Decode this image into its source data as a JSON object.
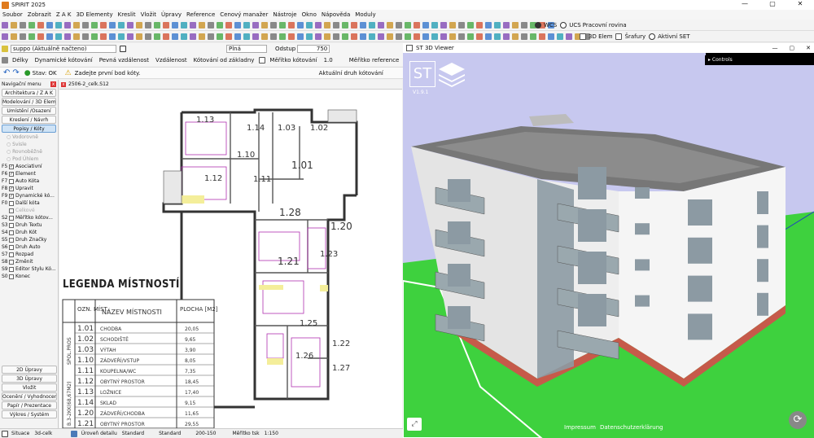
{
  "window": {
    "title": "SPIRIT 2025",
    "controls": [
      "—",
      "▢",
      "✕"
    ]
  },
  "menu": [
    "Soubor",
    "Zobrazit",
    "Z A K",
    "3D Elementy",
    "Kreslit",
    "Vložit",
    "Úpravy",
    "Reference",
    "Cenový manažer",
    "Nástroje",
    "Okno",
    "Nápověda",
    "Moduly"
  ],
  "toolbar": {
    "wcs": "WCS",
    "ucs": "UCS",
    "plane": "Pracovní rovina",
    "elem3d": "3D Elem",
    "hatch": "Šrafury",
    "active_set": "Aktivní SET"
  },
  "layer": {
    "value": "suppo (Aktuálně načteno)",
    "line": "Plná",
    "offset_label": "Odstup",
    "offset_value": "750"
  },
  "dimbar": {
    "items": [
      "Délky",
      "Dynamické kótování",
      "Pevná vzdálenost",
      "Vzdálenost",
      "Kótování od základny"
    ],
    "scale_label": "Měřítko kótování",
    "scale_value": "1.0",
    "ref_label": "Měřítko reference"
  },
  "cmdline": {
    "status": "Stav: OK",
    "prompt": "Zadejte první bod kóty.",
    "dim_type": "Aktuální druh kótování"
  },
  "nav": {
    "header": "Navigační menu",
    "top_buttons": [
      "Architektura / Z A K",
      "Modelování / 3D Elem...",
      "Umístění /Osazení",
      "Kreslení / Návrh",
      "Popisy / Kóty"
    ],
    "radios": [
      "Vodorovně",
      "Svisle",
      "Rovnoběžně",
      "Pod Úhlem"
    ],
    "commands": [
      {
        "key": "F5",
        "label": "Asociativní",
        "checked": true
      },
      {
        "key": "F6",
        "label": "Element",
        "checked": true
      },
      {
        "key": "F7",
        "label": "Auto Kóta",
        "checked": false
      },
      {
        "key": "F8",
        "label": "Upravit",
        "checked": true
      },
      {
        "key": "F9",
        "label": "Dynamické kó...",
        "checked": true
      },
      {
        "key": "F0",
        "label": "Další kóta",
        "checked": false
      },
      {
        "key": "",
        "label": "Celkové",
        "checked": false,
        "disabled": true
      },
      {
        "key": "S2",
        "label": "Měřítko kótov...",
        "checked": false
      },
      {
        "key": "S3",
        "label": "Druh Textu",
        "checked": false
      },
      {
        "key": "S4",
        "label": "Druh Kót",
        "checked": false
      },
      {
        "key": "S5",
        "label": "Druh Značky",
        "checked": false
      },
      {
        "key": "S6",
        "label": "Druh Auto",
        "checked": false
      },
      {
        "key": "S7",
        "label": "Rozpad",
        "checked": false
      },
      {
        "key": "S8",
        "label": "Změnit",
        "checked": false
      },
      {
        "key": "S9",
        "label": "Editor Stylu Kó...",
        "checked": false
      },
      {
        "key": "S0",
        "label": "Konec",
        "checked": false
      }
    ],
    "bottom_buttons": [
      "2D Úpravy",
      "3D Úpravy",
      "Vložit",
      "Ocenění / Vyhodnocení",
      "Papír / Prezentace",
      "Výkres / Systém"
    ]
  },
  "document": {
    "tab": "2506-2_celk.S12"
  },
  "legend": {
    "title": "LEGENDA MÍSTNOSTÍ",
    "col_num": "OZN. MÍST.",
    "col_name": "NÁZEV MÍSTNOSTI",
    "col_area": "PLOCHA [M2]",
    "group1": "SPOL.PROS",
    "group2": "B.3-2KK(68,67M2)",
    "rows": [
      {
        "num": "1.01",
        "name": "CHODBA",
        "area": "20,05"
      },
      {
        "num": "1.02",
        "name": "SCHODIŠTĚ",
        "area": "9,65"
      },
      {
        "num": "1.03",
        "name": "VÝTAH",
        "area": "3,90"
      },
      {
        "num": "1.10",
        "name": "ZÁDVEŘÍ/VSTUP",
        "area": "8,05"
      },
      {
        "num": "1.11",
        "name": "KOUPELNA/WC",
        "area": "7,35"
      },
      {
        "num": "1.12",
        "name": "OBYTNÝ PROSTOR",
        "area": "18,45"
      },
      {
        "num": "1.13",
        "name": "LOŽNICE",
        "area": "17,40"
      },
      {
        "num": "1.14",
        "name": "SKLAD",
        "area": "9,15"
      },
      {
        "num": "1.20",
        "name": "ZÁDVEŘÍ/CHODBA",
        "area": "11,65"
      },
      {
        "num": "1.21",
        "name": "OBYTNÝ PROSTOR",
        "area": "29,55"
      }
    ]
  },
  "plan_rooms": [
    "1.13",
    "1.14",
    "1.03",
    "1.02",
    "1.10",
    "1.11",
    "1.12",
    "1.01",
    "1.28",
    "1.20",
    "1.21",
    "1.23",
    "1.25",
    "1.22",
    "1.26",
    "1.27"
  ],
  "status": {
    "situation": "Situace",
    "layer": "3d-celk",
    "detail_label": "Úroveň detailu",
    "detail_value": "Standard",
    "style": "Standard",
    "scale_range": "200-150",
    "scale_label": "Měřítko tsk",
    "scale_value": "1:150"
  },
  "viewer": {
    "title": "ST 3D Viewer",
    "logo": "ST",
    "version": "V1.9.1",
    "controls": "Controls",
    "links": [
      "Impressum",
      "Datenschutzerklärung"
    ]
  },
  "colors": {
    "sky": "#c7c8ef",
    "grass": "#3ed13e",
    "building": "#ededed",
    "glass": "#8c9aa3",
    "viewer_dark": "#0a0a0a"
  }
}
